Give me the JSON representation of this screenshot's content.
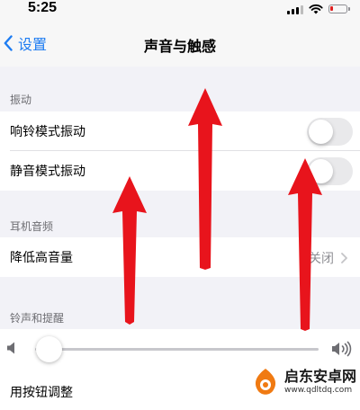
{
  "status_bar": {
    "time": "5:25",
    "battery_level": 0.2,
    "battery_color": "#e02020"
  },
  "nav": {
    "back_label": "设置",
    "title": "声音与触感",
    "accent_color": "#1d7cf2"
  },
  "sections": {
    "vibration": {
      "header": "振动",
      "rows": [
        {
          "label": "响铃模式振动",
          "toggle_on": false
        },
        {
          "label": "静音模式振动",
          "toggle_on": false
        }
      ]
    },
    "headphone_audio": {
      "header": "耳机音频",
      "rows": [
        {
          "label": "降低高音量",
          "value": "关闭"
        }
      ]
    },
    "ringer_alerts": {
      "header": "铃声和提醒",
      "volume_level": 0.05,
      "change_with_buttons_label": "用按钮调整"
    }
  },
  "annotation": {
    "arrow_color": "#e8141c",
    "arrow_count": 4
  },
  "watermark": {
    "name": "启东安卓网",
    "url": "www.qdltdq.com"
  }
}
